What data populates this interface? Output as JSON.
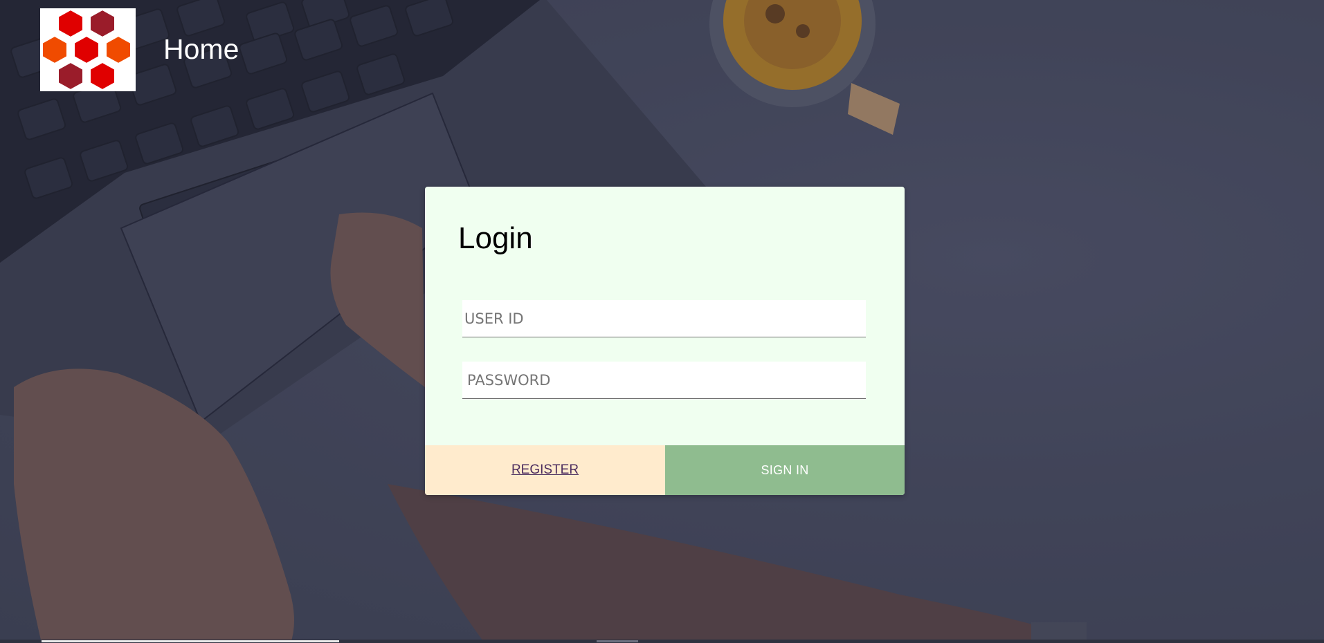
{
  "header": {
    "title": "Home"
  },
  "login": {
    "heading": "Login",
    "user_id_placeholder": "USER ID",
    "user_id_value": "",
    "password_placeholder": "PASSWORD",
    "password_value": "",
    "register_label": "REGISTER",
    "signin_label": "SIGN IN"
  },
  "icons": {
    "logo": "hexagon-cluster-logo"
  },
  "colors": {
    "card_background": "#f0fff0",
    "register_background": "#ffebcd",
    "signin_background": "#8fbc8f",
    "logo_red": "#e00000",
    "logo_orange": "#f04b00",
    "logo_dark_red": "#9a1c2a"
  }
}
